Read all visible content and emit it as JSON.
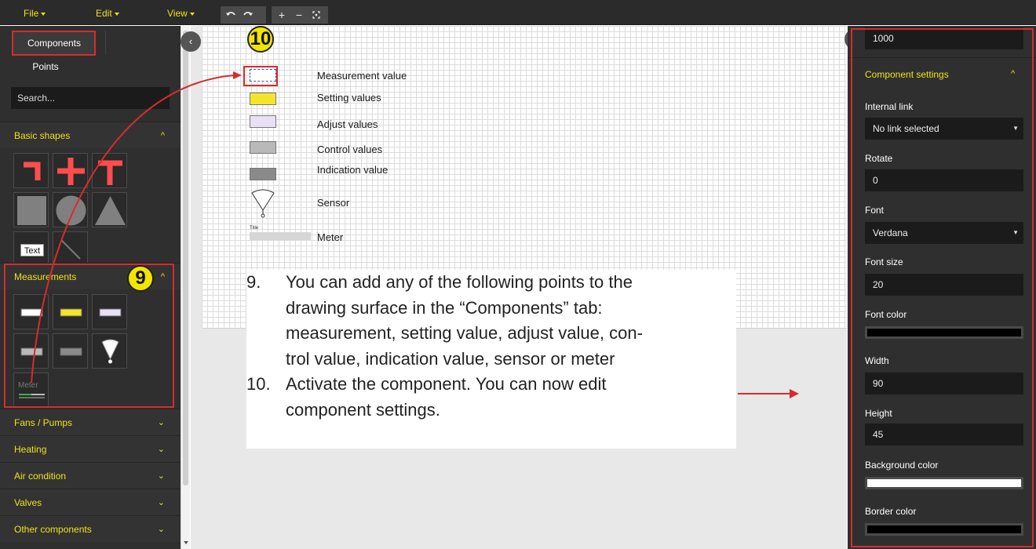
{
  "menubar": {
    "file": "File",
    "edit": "Edit",
    "view": "View",
    "tools": [
      "undo-icon",
      "redo-icon"
    ],
    "zoom": {
      "plus": "+",
      "minus": "−",
      "fit": "fit-icon"
    }
  },
  "left": {
    "tabs": [
      "Components",
      "Points"
    ],
    "search_placeholder": "Search...",
    "sections": {
      "basic": "Basic shapes",
      "measurements": "Measurements",
      "fans": "Fans / Pumps",
      "heating": "Heating",
      "air": "Air condition",
      "valves": "Valves",
      "other": "Other components"
    },
    "text_tile": "Text",
    "meter_tile": "Meter"
  },
  "legend": {
    "measurement": "Measurement value",
    "setting": "Setting values",
    "adjust": "Adjust values",
    "control": "Control values",
    "indication": "Indication value",
    "sensor": "Sensor",
    "meter": "Meter",
    "meter_title": "Title"
  },
  "instructions": {
    "n9": "9.",
    "t9_l1": "You can add any of the following points to the",
    "t9_l2": "drawing surface in the “Components” tab:",
    "t9_l3": "measurement, setting value, adjust value, con-",
    "t9_l4": "trol value, indication value, sensor or meter",
    "n10": "10.",
    "t10_l1": "Activate the component. You can now edit",
    "t10_l2": "component settings."
  },
  "badges": {
    "b9": "9",
    "b10": "10"
  },
  "right": {
    "top_value": "1000",
    "header": "Component settings",
    "internal_link_label": "Internal link",
    "internal_link_value": "No link selected",
    "rotate_label": "Rotate",
    "rotate_value": "0",
    "font_label": "Font",
    "font_value": "Verdana",
    "font_size_label": "Font size",
    "font_size_value": "20",
    "font_color_label": "Font color",
    "width_label": "Width",
    "width_value": "90",
    "height_label": "Height",
    "height_value": "45",
    "bg_color_label": "Background color",
    "border_color_label": "Border color"
  },
  "colors": {
    "accent": "#f0e01a",
    "annotation_red": "#d62c2c",
    "shape_red": "#ff4d4d",
    "measurement": "#ffffff",
    "setting": "#f5e52a",
    "adjust": "#e8e0f5",
    "control": "#b9b9b9",
    "indication": "#8a8a8a",
    "font_color": "#000000",
    "background_color": "#ffffff",
    "border_color": "#000000"
  }
}
